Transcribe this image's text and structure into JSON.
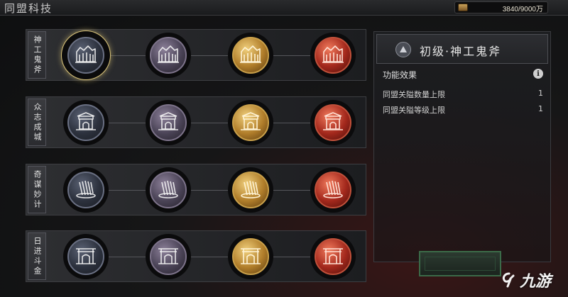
{
  "header": {
    "title": "同盟科技",
    "currency_value": "3840/9000万",
    "currency_icon": "treasure-chest-icon"
  },
  "rows": [
    {
      "label": "神工鬼斧",
      "icon": "fortress-gate-icon",
      "selected_index": 0
    },
    {
      "label": "众志成城",
      "icon": "city-gate-icon",
      "selected_index": -1
    },
    {
      "label": "奇谋妙计",
      "icon": "bamboo-scroll-icon",
      "selected_index": -1
    },
    {
      "label": "日进斗金",
      "icon": "archway-gate-icon",
      "selected_index": -1
    }
  ],
  "tier_colors": [
    "#4a5060",
    "#6e6480",
    "#c99a3e",
    "#b8352a"
  ],
  "panel": {
    "emblem_icon": "mountain-emblem-icon",
    "title": "初级·神工鬼斧",
    "effect_header": "功能效果",
    "info_label": "i",
    "effects": [
      {
        "label": "同盟关隘数量上限",
        "value": "1"
      },
      {
        "label": "同盟关隘等级上限",
        "value": "1"
      }
    ]
  },
  "watermark": {
    "text": "九游"
  }
}
